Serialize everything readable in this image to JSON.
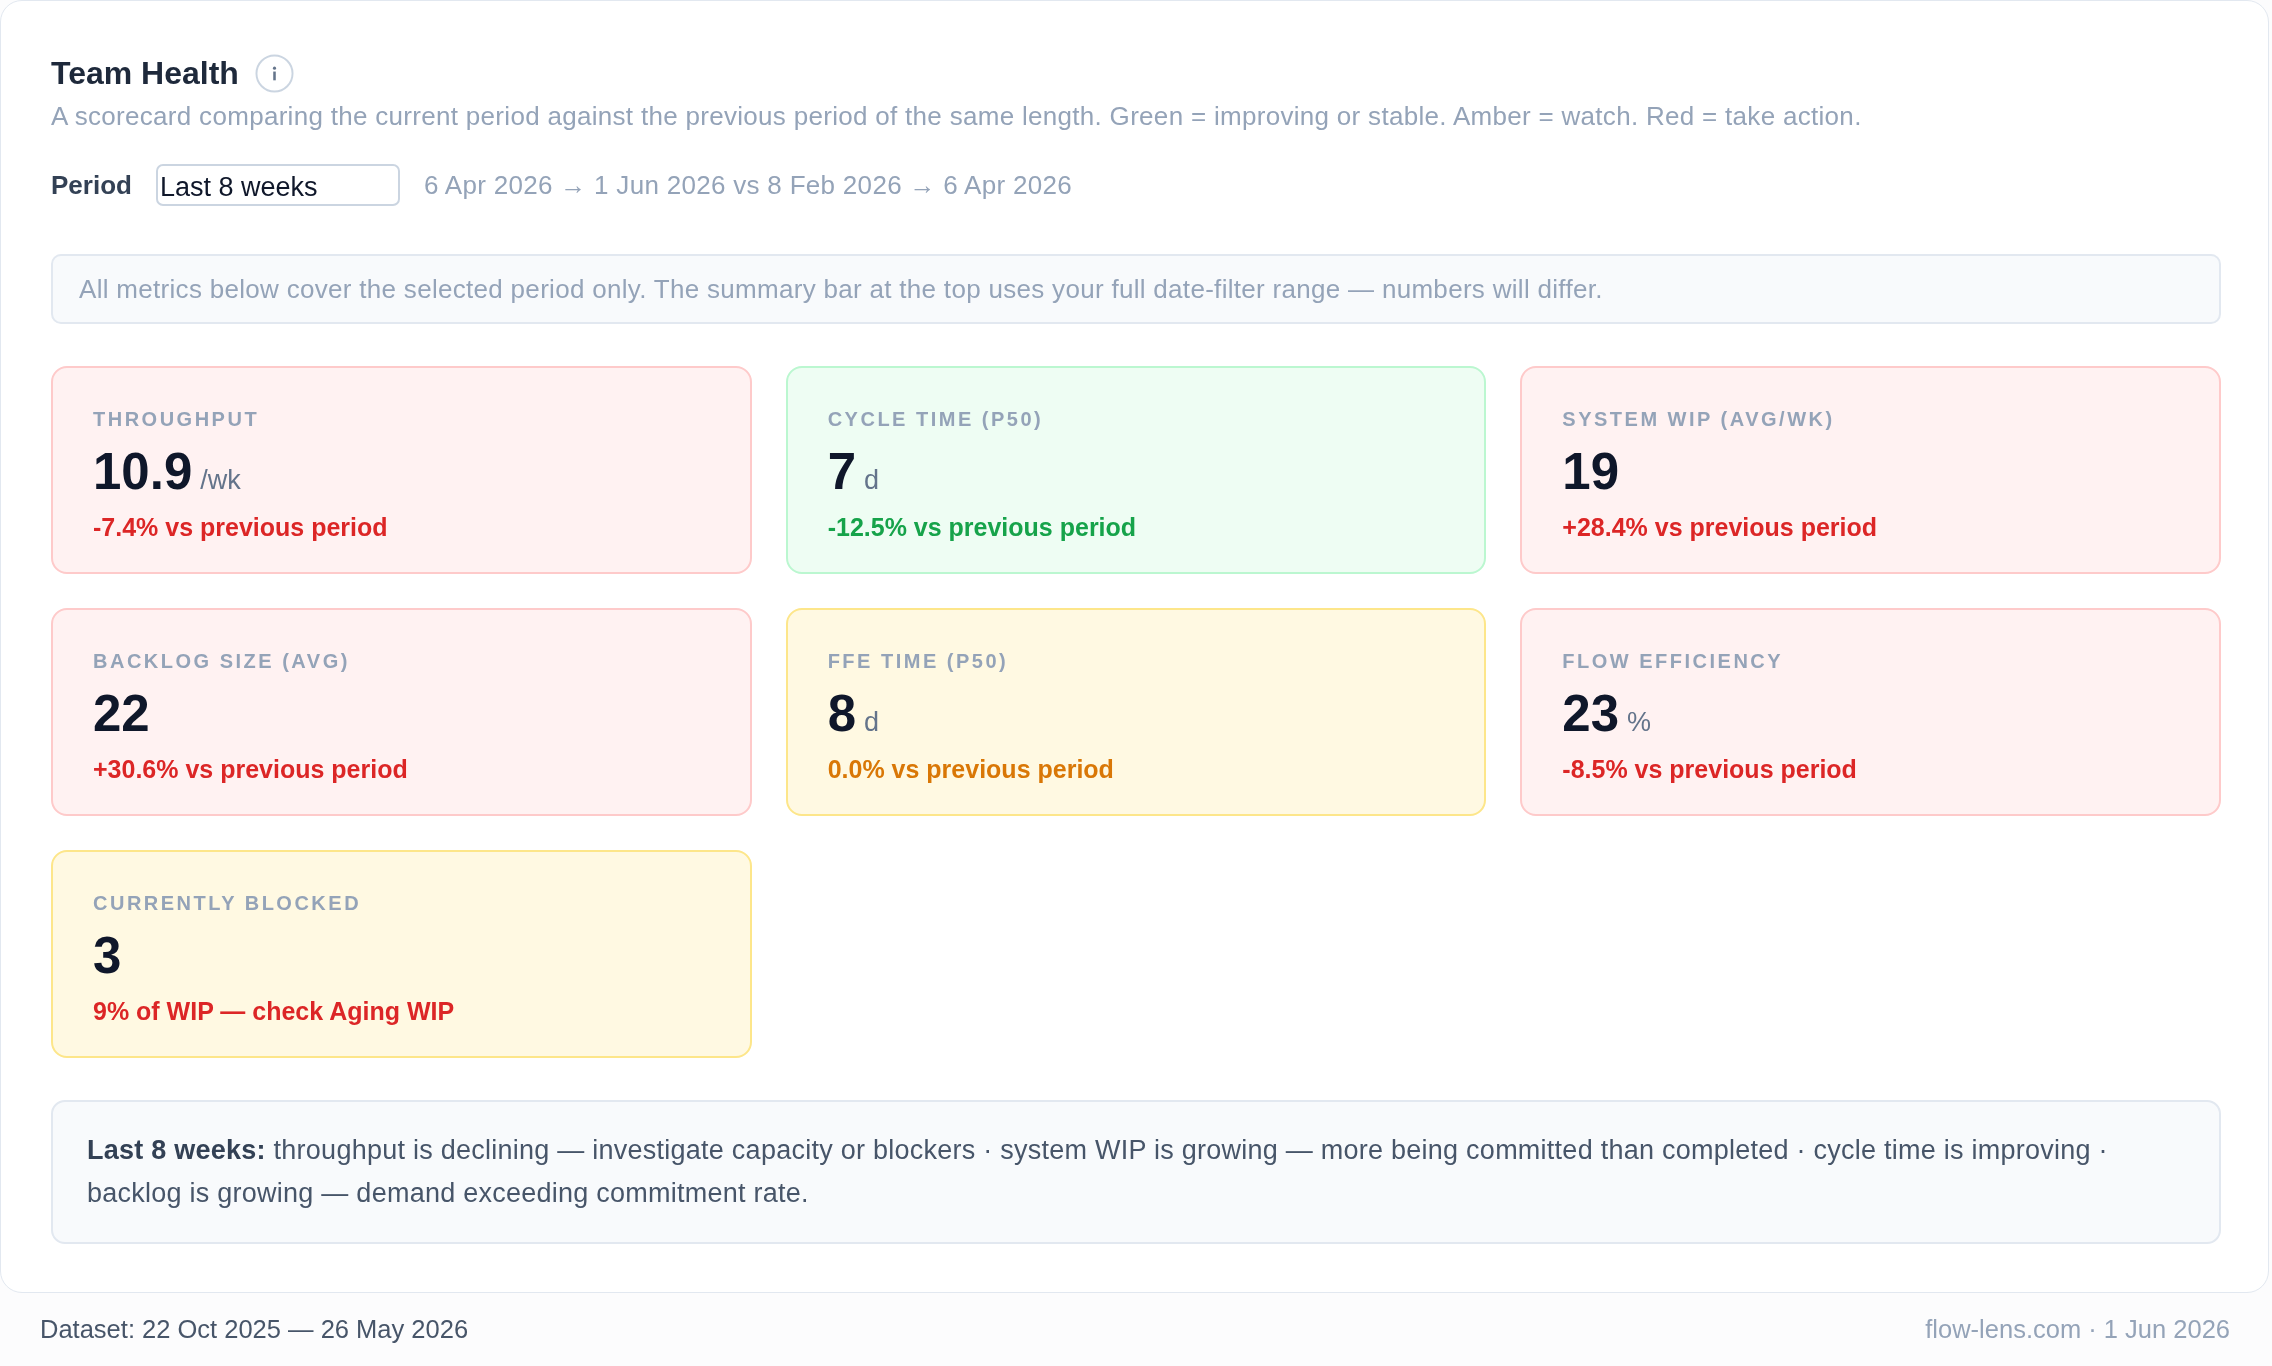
{
  "header": {
    "title": "Team Health",
    "subtitle": "A scorecard comparing the current period against the previous period of the same length. Green = improving or stable. Amber = watch. Red = take action."
  },
  "period": {
    "label": "Period",
    "value": "Last 8 weeks",
    "range": "6 Apr 2026 → 1 Jun 2026 vs 8 Feb 2026 → 6 Apr 2026"
  },
  "notice": "All metrics below cover the selected period only. The summary bar at the top uses your full date-filter range — numbers will differ.",
  "metrics": [
    {
      "label": "THROUGHPUT",
      "value": "10.9",
      "unit": "/wk",
      "color": "#fecaca",
      "change": {
        "text": "-7.4% vs previous period",
        "color": "#dc2626"
      }
    },
    {
      "label": "CYCLE TIME (P50)",
      "value": "7",
      "unit": "d",
      "color": "#bbf7d0",
      "change": {
        "text": "-12.5% vs previous period",
        "color": "#16a34a"
      }
    },
    {
      "label": "SYSTEM WIP (AVG/WK)",
      "value": "19",
      "color": "#fecaca",
      "change": {
        "text": "+28.4% vs previous period",
        "color": "#dc2626"
      }
    },
    {
      "label": "BACKLOG SIZE (AVG)",
      "value": "22",
      "color": "#fecaca",
      "change": {
        "text": "+30.6% vs previous period",
        "color": "#dc2626"
      }
    },
    {
      "label": "FFE TIME (P50)",
      "value": "8",
      "unit": "d",
      "color": "#fde68a",
      "change": {
        "text": "0.0% vs previous period",
        "color": "#d97706"
      }
    },
    {
      "label": "FLOW EFFICIENCY",
      "value": "23",
      "unit": "%",
      "color": "#fecaca",
      "change": {
        "text": "-8.5% vs previous period",
        "color": "#dc2626"
      }
    },
    {
      "label": "CURRENTLY BLOCKED",
      "value": "3",
      "color": "#fde68a",
      "change": {
        "text": "9% of WIP — check Aging WIP",
        "color": "#dc2626"
      }
    }
  ],
  "summary": "**Last 8 weeks:** throughput is declining — investigate capacity or blockers · system WIP is growing — more being committed than completed · cycle time is improving · backlog is growing — demand exceeding commitment rate.",
  "footer": {
    "dataset": "Dataset: 22 Oct 2025 — 26 May 2026",
    "source": "flow-lens.com · 1 Jun 2026"
  }
}
